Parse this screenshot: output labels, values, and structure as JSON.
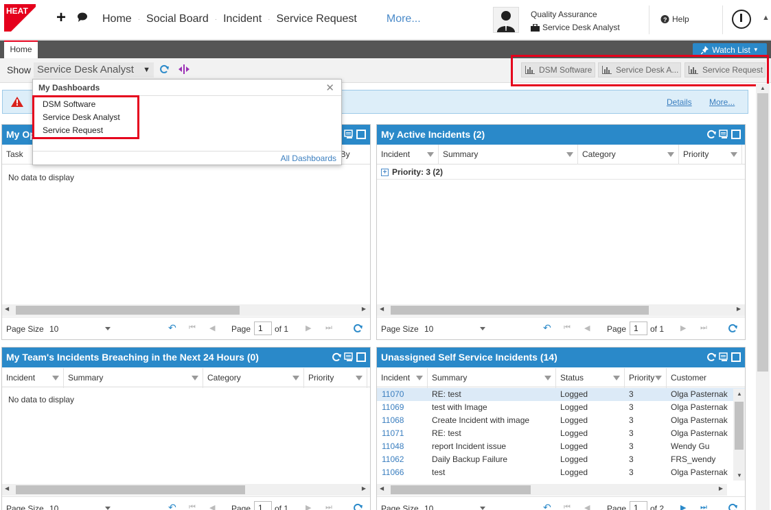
{
  "logo_text": "HEAT",
  "nav": {
    "items": [
      "Home",
      "Social Board",
      "Incident",
      "Service Request"
    ],
    "more": "More..."
  },
  "user": {
    "name": "Quality Assurance",
    "role": "Service Desk Analyst"
  },
  "help": "Help",
  "tabs": {
    "home": "Home"
  },
  "watch_list": "Watch List",
  "show": {
    "label": "Show",
    "selected": "Service Desk Analyst"
  },
  "quick_dashboards": [
    "DSM Software",
    "Service Desk A...",
    "Service Request"
  ],
  "alert": {
    "details": "Details",
    "more": "More..."
  },
  "dropdown": {
    "title": "My Dashboards",
    "items": [
      "DSM Software",
      "Service Desk Analyst",
      "Service Request"
    ],
    "all": "All Dashboards"
  },
  "panels": {
    "open_tasks": {
      "title": "My Op",
      "cols": [
        "Task",
        "ed By"
      ],
      "no_data": "No data to display",
      "pager": {
        "size_label": "Page Size",
        "size": "10",
        "page_label": "Page",
        "page": "1",
        "of": "of 1"
      }
    },
    "active_incidents": {
      "title": "My Active Incidents (2)",
      "cols": [
        "Incident",
        "Summary",
        "Category",
        "Priority"
      ],
      "group": "Priority: 3 (2)",
      "pager": {
        "size_label": "Page Size",
        "size": "10",
        "page_label": "Page",
        "page": "1",
        "of": "of 1"
      }
    },
    "team_breaching": {
      "title": "My Team's Incidents Breaching in the Next 24 Hours (0)",
      "cols": [
        "Incident",
        "Summary",
        "Category",
        "Priority"
      ],
      "no_data": "No data to display",
      "pager": {
        "size_label": "Page Size",
        "size": "10",
        "page_label": "Page",
        "page": "1",
        "of": "of 1"
      }
    },
    "unassigned": {
      "title": "Unassigned Self Service Incidents (14)",
      "cols": [
        "Incident",
        "Summary",
        "Status",
        "Priority",
        "Customer"
      ],
      "rows": [
        [
          "11070",
          "RE: test",
          "Logged",
          "3",
          "Olga Pasternak"
        ],
        [
          "11069",
          "test with Image",
          "Logged",
          "3",
          "Olga Pasternak"
        ],
        [
          "11068",
          "Create Incident with image",
          "Logged",
          "3",
          "Olga Pasternak"
        ],
        [
          "11071",
          "RE: test",
          "Logged",
          "3",
          "Olga Pasternak"
        ],
        [
          "11048",
          "report Incident issue",
          "Logged",
          "3",
          "Wendy Gu"
        ],
        [
          "11062",
          "Daily Backup Failure",
          "Logged",
          "3",
          "FRS_wendy"
        ],
        [
          "11066",
          "test",
          "Logged",
          "3",
          "Olga Pasternak"
        ]
      ],
      "pager": {
        "size_label": "Page Size",
        "size": "10",
        "page_label": "Page",
        "page": "1",
        "of": "of 2"
      }
    }
  },
  "colors": {
    "brand_red": "#e5001c",
    "header_blue": "#2a89c9",
    "link_blue": "#3a7ebf",
    "alert_bg": "#ddeef9",
    "tabbar": "#555555"
  }
}
